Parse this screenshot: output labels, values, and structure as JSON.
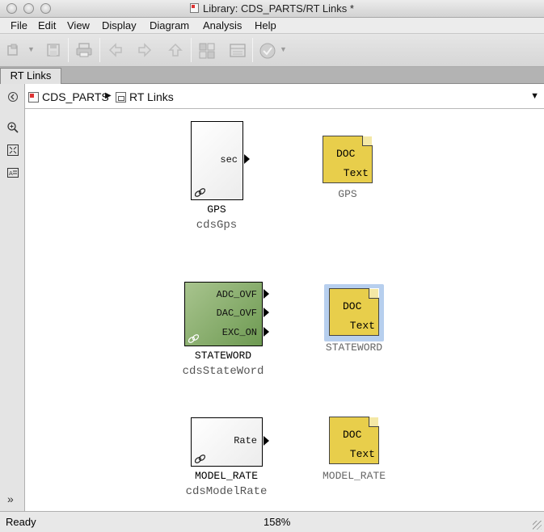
{
  "window": {
    "title": "Library: CDS_PARTS/RT Links *"
  },
  "menu": [
    "File",
    "Edit",
    "View",
    "Display",
    "Diagram",
    "Analysis",
    "Help"
  ],
  "tab": {
    "label": "RT Links"
  },
  "breadcrumb": {
    "root": "CDS_PARTS",
    "current": "RT Links"
  },
  "blocks": {
    "gps": {
      "port": "sec",
      "name": "GPS",
      "type": "cdsGps"
    },
    "stateword": {
      "ports": [
        "ADC_OVF",
        "DAC_OVF",
        "EXC_ON"
      ],
      "name": "STATEWORD",
      "type": "cdsStateWord"
    },
    "model_rate": {
      "port": "Rate",
      "name": "MODEL_RATE",
      "type": "cdsModelRate"
    }
  },
  "docs": {
    "gps": {
      "top": "DOC",
      "bottom": "Text",
      "name": "GPS"
    },
    "stateword": {
      "top": "DOC",
      "bottom": "Text",
      "name": "STATEWORD"
    },
    "model_rate": {
      "top": "DOC",
      "bottom": "Text",
      "name": "MODEL_RATE"
    }
  },
  "status": {
    "text": "Ready",
    "zoom": "158%"
  },
  "colors": {
    "doc_block": "#e8ce4b",
    "stateword_block": "#8bb06f",
    "selection": "#b7cfee"
  }
}
